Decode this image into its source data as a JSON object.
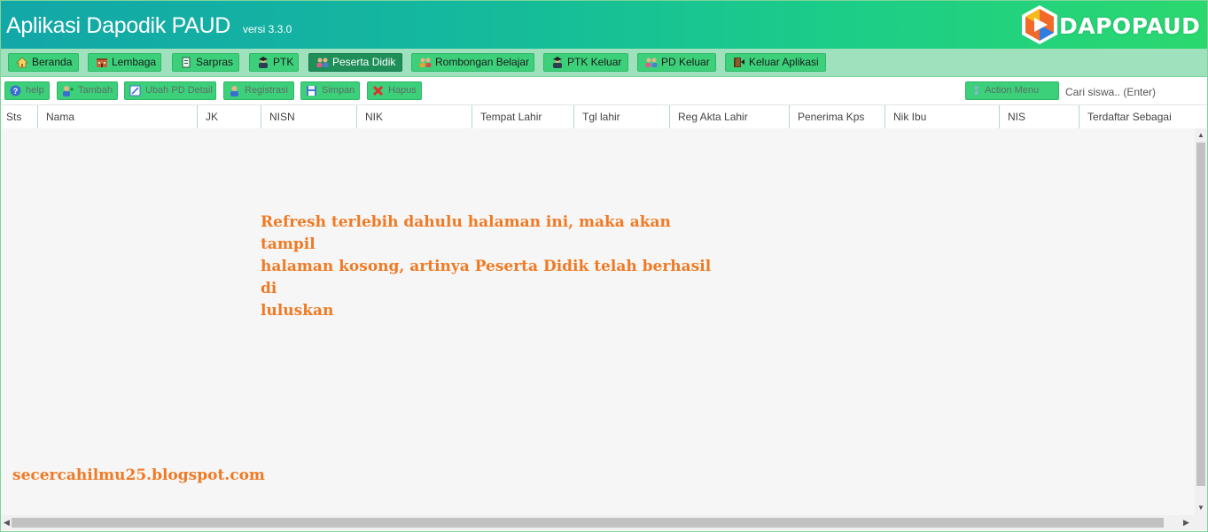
{
  "app": {
    "title": "Aplikasi Dapodik PAUD",
    "version": "versi 3.3.0",
    "logo_text_dapo": "DAPO",
    "logo_text_paud": "PAUD"
  },
  "nav": {
    "items": [
      {
        "label": "Beranda",
        "icon": "home-icon"
      },
      {
        "label": "Lembaga",
        "icon": "building-icon"
      },
      {
        "label": "Sarpras",
        "icon": "sarpras-icon"
      },
      {
        "label": "PTK",
        "icon": "teacher-icon"
      },
      {
        "label": "Peserta Didik",
        "icon": "students-icon",
        "active": true
      },
      {
        "label": "Rombongan Belajar",
        "icon": "group-icon"
      },
      {
        "label": "PTK Keluar",
        "icon": "teacher-exit-icon"
      },
      {
        "label": "PD Keluar",
        "icon": "students-exit-icon"
      },
      {
        "label": "Keluar Aplikasi",
        "icon": "logout-icon"
      }
    ]
  },
  "toolbar": {
    "help_label": "help",
    "tambah_label": "Tambah",
    "ubah_label": "Ubah PD Detail",
    "registrasi_label": "Registrasi",
    "simpan_label": "Simpan",
    "hapus_label": "Hapus",
    "action_menu_label": "Action Menu",
    "search_placeholder": "Cari siswa.. (Enter)"
  },
  "grid": {
    "columns": [
      "Sts",
      "Nama",
      "JK",
      "NISN",
      "NIK",
      "Tempat Lahir",
      "Tgl lahir",
      "Reg Akta Lahir",
      "Penerima Kps",
      "Nik Ibu",
      "NIS",
      "Terdaftar Sebagai"
    ],
    "rows": []
  },
  "annotation": {
    "line1": "Refresh terlebih dahulu halaman ini, maka akan tampil",
    "line2": "halaman kosong, artinya Peserta Didik telah berhasil di",
    "line3": "luluskan"
  },
  "watermark": "secercahilmu25.blogspot.com",
  "colors": {
    "header_gradient_start": "#13a7a8",
    "header_gradient_end": "#2bd86f",
    "nav_bg": "#9fe0bd",
    "button_green": "#3dd07a",
    "active_nav": "#1f8f5a",
    "annotation_orange": "#f07a24"
  }
}
